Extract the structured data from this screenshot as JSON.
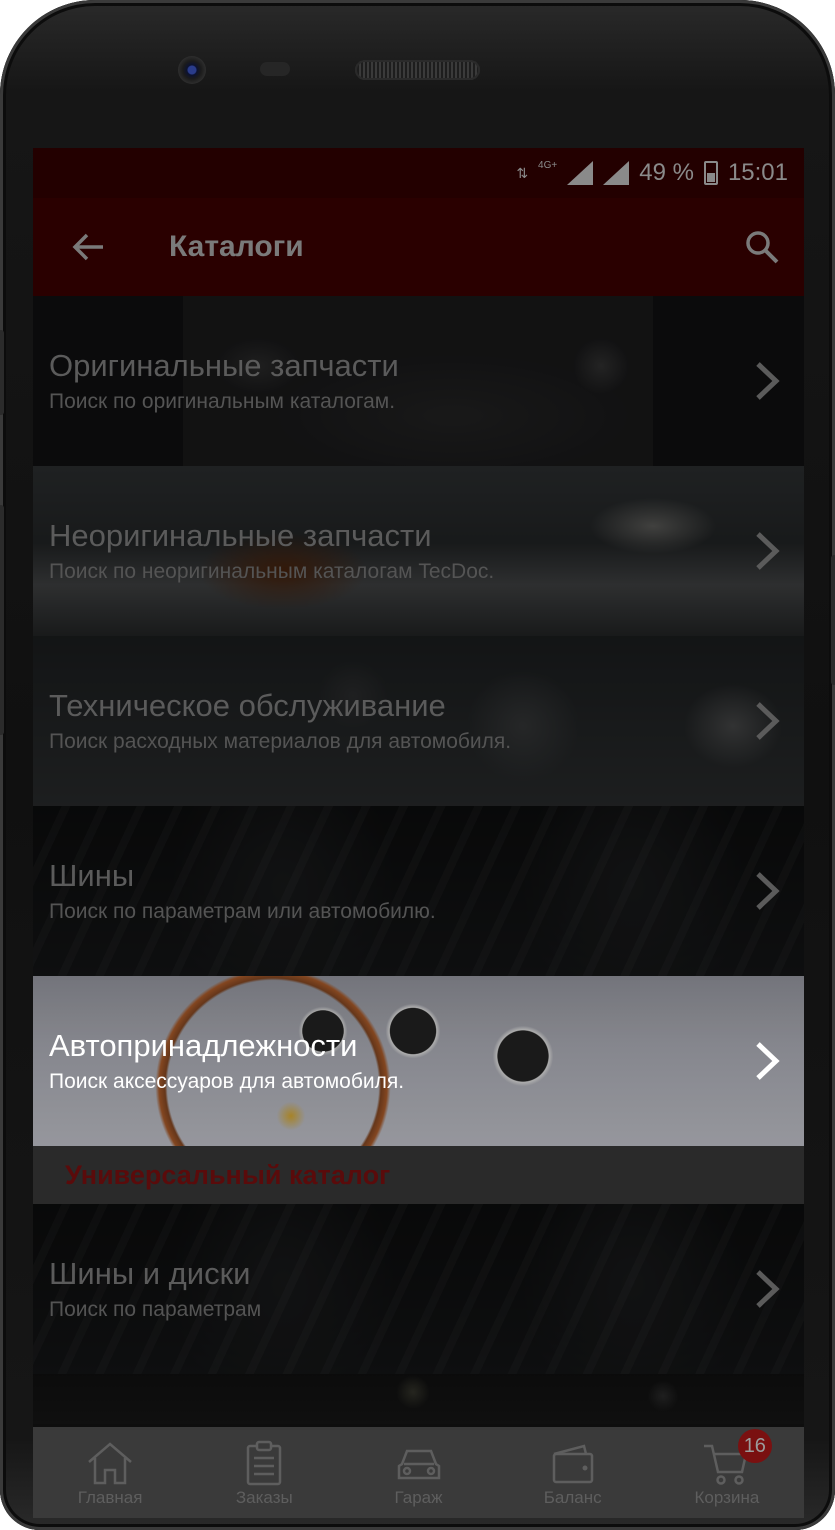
{
  "status_bar": {
    "network": "4G+",
    "battery": "49 %",
    "time": "15:01"
  },
  "app_bar": {
    "back_icon": "arrow-left-icon",
    "title": "Каталоги",
    "search_icon": "search-icon"
  },
  "catalogs": [
    {
      "title": "Оригинальные запчасти",
      "subtitle": "Поиск по оригинальным каталогам."
    },
    {
      "title": "Неоригинальные запчасти",
      "subtitle": "Поиск по неоригинальным каталогам TecDoc."
    },
    {
      "title": "Техническое обслуживание",
      "subtitle": "Поиск расходных материалов для автомобиля."
    },
    {
      "title": "Шины",
      "subtitle": "Поиск по параметрам или автомобилю."
    },
    {
      "title": "Автопринадлежности",
      "subtitle": "Поиск аксессуаров для автомобиля."
    }
  ],
  "universal_section": {
    "heading": "Универсальный каталог",
    "items": [
      {
        "title": "Шины и диски",
        "subtitle": "Поиск по параметрам"
      }
    ]
  },
  "bottom_nav": [
    {
      "label": "Главная",
      "icon": "home-icon"
    },
    {
      "label": "Заказы",
      "icon": "clipboard-icon"
    },
    {
      "label": "Гараж",
      "icon": "car-icon"
    },
    {
      "label": "Баланс",
      "icon": "wallet-icon"
    },
    {
      "label": "Корзина",
      "icon": "cart-icon",
      "badge": "16"
    }
  ],
  "colors": {
    "status_bar": "#230000",
    "app_bar": "#2a0000",
    "section_heading": "#5a0b0b",
    "badge": "#7a1010"
  }
}
